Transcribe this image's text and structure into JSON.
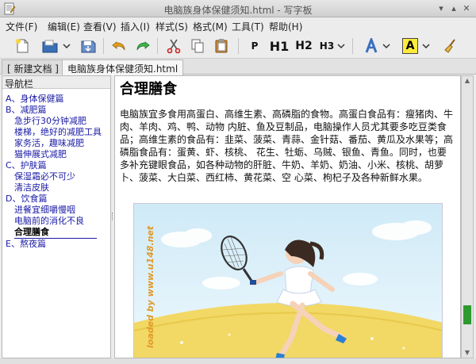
{
  "window": {
    "title": "电脑族身体保健须知.html - 写字板"
  },
  "menu": {
    "items": [
      "文件(F)",
      "编辑(E)",
      "查看(V)",
      "插入(I)",
      "样式(S)",
      "格式(M)",
      "工具(T)",
      "帮助(H)"
    ]
  },
  "toolbar": {
    "paragraph": "P",
    "h1": "H1",
    "h2": "H2",
    "h3": "H3",
    "highlight": "A",
    "colors": {
      "accent_green": "#2e9a2e",
      "highlight_yellow": "#ffeb3b",
      "link_blue": "#1a1aa6"
    }
  },
  "tabs": [
    {
      "label": "[ 新建文档 ] 1"
    },
    {
      "label": "电脑族身体保健须知.html"
    }
  ],
  "nav": {
    "title": "导航栏",
    "items": [
      "A、身体保健篇",
      "B、减肥篇",
      "急步行30分钟减肥",
      "楼梯，绝好的减肥工具",
      "家务活，趣味减肥",
      "猫伸展式减肥",
      "C、护肤篇",
      "保湿霜必不可少",
      "清洁皮肤",
      "D、饮食篇",
      "进餐宜细嚼慢咽",
      "电脑前的消化不良",
      "合理膳食",
      "E、熬夜篇"
    ],
    "current": "合理膳食"
  },
  "document": {
    "heading": "合理膳食",
    "paragraph": "电脑族宜多食用高蛋白、高维生素、高磷脂的食物。高蛋白食品有：瘦猪肉、牛肉、羊肉、鸡、鸭、动物 内脏、鱼及豆制品，电脑操作人员尤其要多吃豆类食品；高维生素的食品有：韭菜、菠菜、青蒜、金针菇、番茄、黄瓜及水果等；高磷脂食品有：蛋黄、虾、核桃、 花生、牡蛎、乌贼、银鱼、青鱼。同时，也要多补充键眼食品，如各种动物的肝脏、牛奶、羊奶、奶油、小米、核桃、胡萝卜、菠菜、大白菜、西红柿、黄花菜、空 心菜、枸杞子及各种新鲜水果。",
    "watermark": "loaded by www.u148.net"
  }
}
